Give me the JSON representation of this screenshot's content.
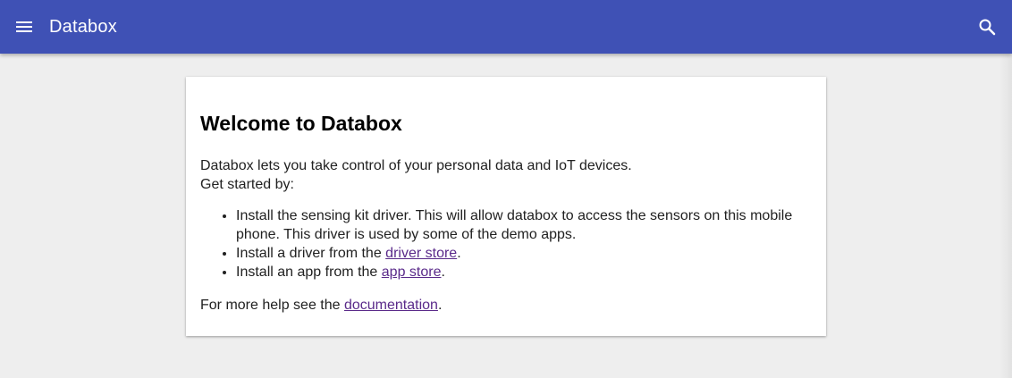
{
  "appbar": {
    "title": "Databox",
    "menu_icon": "menu-icon",
    "search_icon": "search-icon",
    "color": "#3f51b5"
  },
  "card": {
    "heading": "Welcome to Databox",
    "intro_line1": "Databox lets you take control of your personal data and IoT devices.",
    "intro_line2": "Get started by:",
    "steps": [
      {
        "text": "Install the sensing kit driver. This will allow databox to access the sensors on this mobile phone. This driver is used by some of the demo apps."
      },
      {
        "prefix": "Install a driver from the ",
        "link": "driver store",
        "suffix": "."
      },
      {
        "prefix": "Install an app from the ",
        "link": "app store",
        "suffix": "."
      }
    ],
    "help": {
      "prefix": "For more help see the ",
      "link": "documentation",
      "suffix": "."
    }
  }
}
